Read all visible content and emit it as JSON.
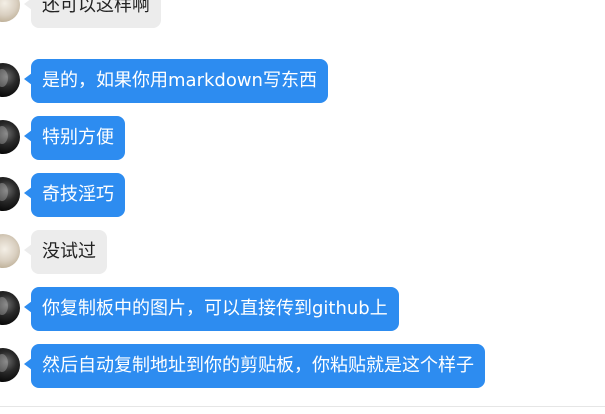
{
  "chat": {
    "messages": [
      {
        "text": "还可以这样啊",
        "style": "gray",
        "avatar": "light"
      },
      {
        "text": "是的，如果你用markdown写东西",
        "style": "blue",
        "avatar": "dark"
      },
      {
        "text": "特别方便",
        "style": "blue",
        "avatar": "dark"
      },
      {
        "text": "奇技淫巧",
        "style": "blue",
        "avatar": "dark"
      },
      {
        "text": "没试过",
        "style": "gray",
        "avatar": "light"
      },
      {
        "text": "你复制板中的图片，可以直接传到github上",
        "style": "blue",
        "avatar": "dark"
      },
      {
        "text": "然后自动复制地址到你的剪贴板，你粘贴就是这个样子",
        "style": "blue",
        "avatar": "dark"
      }
    ]
  },
  "colors": {
    "sent_bubble": "#2d8cf0",
    "received_bubble": "#ececec"
  }
}
